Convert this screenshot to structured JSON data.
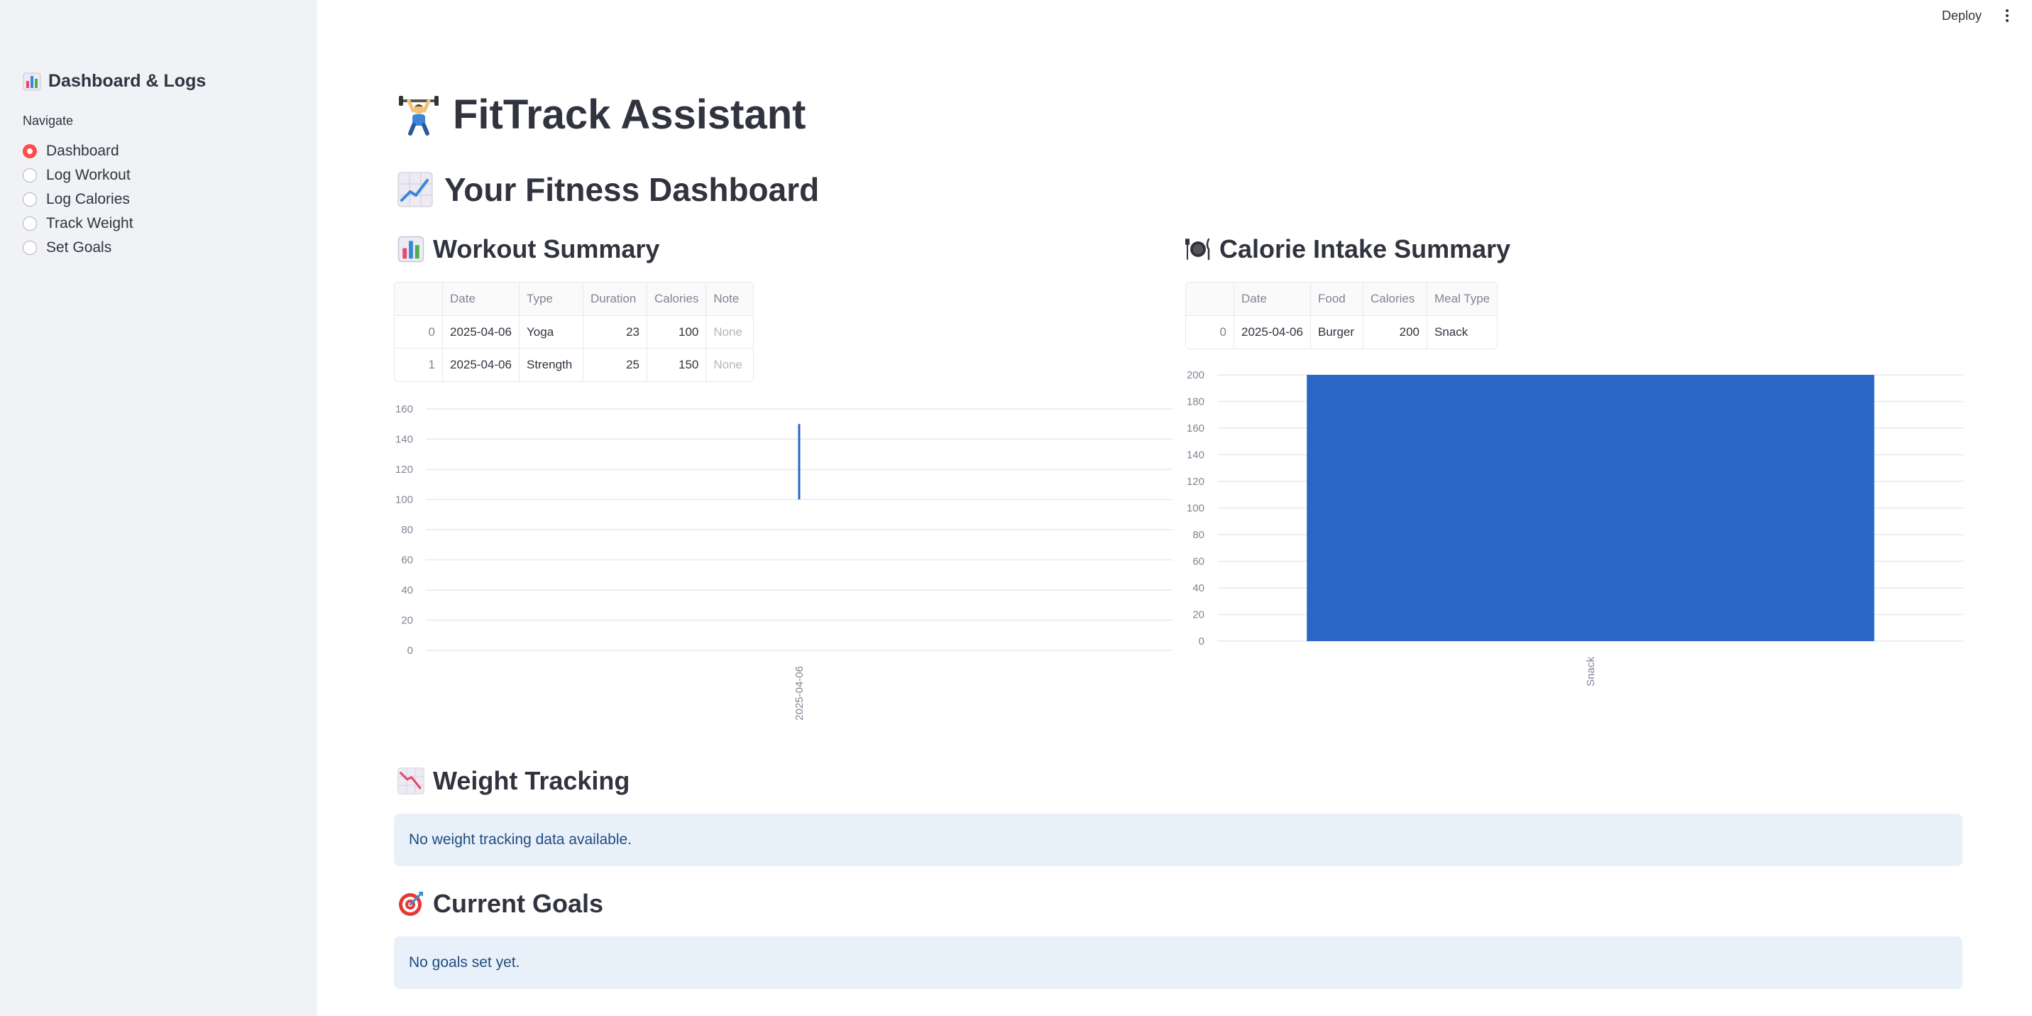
{
  "header": {
    "deploy_label": "Deploy"
  },
  "sidebar": {
    "title": "Dashboard & Logs",
    "nav_label": "Navigate",
    "items": [
      {
        "label": "Dashboard",
        "selected": true
      },
      {
        "label": "Log Workout",
        "selected": false
      },
      {
        "label": "Log Calories",
        "selected": false
      },
      {
        "label": "Track Weight",
        "selected": false
      },
      {
        "label": "Set Goals",
        "selected": false
      }
    ]
  },
  "main": {
    "app_title": "FitTrack Assistant",
    "dashboard_title": "Your Fitness Dashboard",
    "workout": {
      "title": "Workout Summary",
      "columns": [
        "",
        "Date",
        "Type",
        "Duration",
        "Calories",
        "Note"
      ],
      "rows": [
        [
          "0",
          "2025-04-06",
          "Yoga",
          "23",
          "100",
          "None"
        ],
        [
          "1",
          "2025-04-06",
          "Strength",
          "25",
          "150",
          "None"
        ]
      ]
    },
    "calorie": {
      "title": "Calorie Intake Summary",
      "columns": [
        "",
        "Date",
        "Food",
        "Calories",
        "Meal Type"
      ],
      "rows": [
        [
          "0",
          "2025-04-06",
          "Burger",
          "200",
          "Snack"
        ]
      ]
    },
    "weight": {
      "title": "Weight Tracking",
      "message": "No weight tracking data available."
    },
    "goals": {
      "title": "Current Goals",
      "message": "No goals set yet."
    }
  },
  "chart_data": [
    {
      "type": "bar",
      "categories": [
        "2025-04-06"
      ],
      "series": [
        {
          "values": [
            100,
            150
          ]
        }
      ],
      "bar_ranges": [
        [
          100,
          150
        ]
      ],
      "yticks": [
        0,
        20,
        40,
        60,
        80,
        100,
        120,
        140,
        160
      ],
      "ylim": [
        0,
        160
      ],
      "color": "#2a66c4",
      "grid": true
    },
    {
      "type": "bar",
      "categories": [
        "Snack"
      ],
      "values": [
        200
      ],
      "yticks": [
        0,
        20,
        40,
        60,
        80,
        100,
        120,
        140,
        160,
        180,
        200
      ],
      "ylim": [
        0,
        200
      ],
      "color": "#2a66c4",
      "grid": true
    }
  ]
}
